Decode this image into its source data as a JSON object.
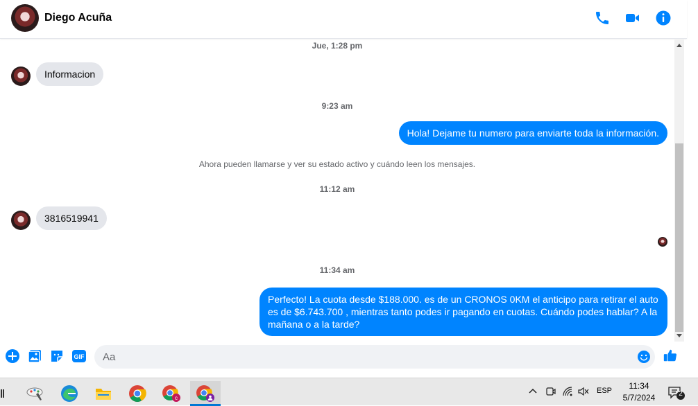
{
  "header": {
    "contact_name": "Diego Acuña",
    "icons": [
      "phone-icon",
      "video-camera-icon",
      "info-icon"
    ],
    "accent_color": "#0084ff"
  },
  "messages": {
    "items": [
      {
        "type": "timestamp",
        "text": "Jue, 1:28 pm"
      },
      {
        "type": "incoming",
        "text": "Informacion"
      },
      {
        "type": "timestamp",
        "text": "9:23 am"
      },
      {
        "type": "outgoing",
        "text": "Hola! Dejame tu numero  para enviarte toda la información."
      },
      {
        "type": "system",
        "text": "Ahora pueden llamarse y ver su estado activo y cuándo leen los mensajes."
      },
      {
        "type": "timestamp",
        "text": "11:12 am"
      },
      {
        "type": "incoming",
        "text": "3816519941"
      },
      {
        "type": "timestamp",
        "text": "11:34 am"
      },
      {
        "type": "outgoing",
        "text": "Perfecto! La cuota desde $188.000. es de un CRONOS 0KM el anticipo para retirar el auto es de $6.743.700 , mientras tanto podes ir pagando en cuotas. Cuándo podes hablar? A la mañana o a la tarde?"
      }
    ]
  },
  "composer": {
    "placeholder": "Aa",
    "icons": [
      "add-icon",
      "image-icon",
      "sticker-icon",
      "gif-icon",
      "emoji-icon",
      "like-icon"
    ],
    "gif_label": "GIF"
  },
  "taskbar": {
    "apps": [
      "paint-app-icon",
      "edge-icon",
      "file-explorer-icon",
      "chrome-icon",
      "chrome-profile-icon",
      "chrome-active-icon"
    ],
    "language": "ESP",
    "time": "11:34",
    "date": "5/7/2024",
    "notification_count": "2"
  }
}
